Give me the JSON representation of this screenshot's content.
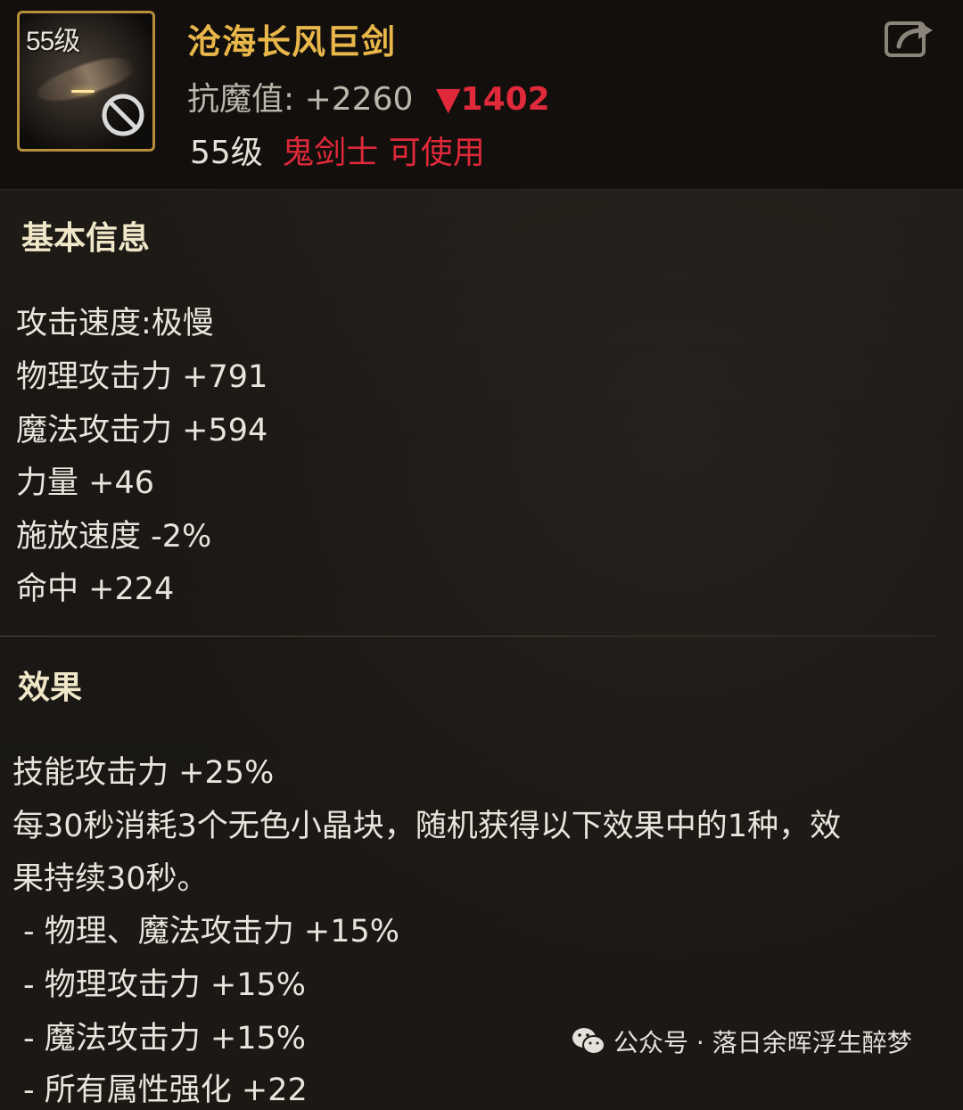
{
  "item": {
    "level_badge": "55级",
    "name": "沧海长风巨剑",
    "resist_label": "抗魔值:",
    "resist_value": "+2260",
    "resist_diff": "▼1402",
    "req_level": "55级",
    "req_class": "鬼剑士 可使用"
  },
  "colors": {
    "name": "#e9b64a",
    "warning_red": "#e0293a",
    "icon_border": "#b58f3b"
  },
  "basic": {
    "title": "基本信息",
    "stats": [
      "攻击速度:极慢",
      "物理攻击力 +791",
      "魔法攻击力 +594",
      "力量 +46",
      "施放速度 -2%",
      "命中 +224"
    ]
  },
  "effects": {
    "title": "效果",
    "lines": [
      "技能攻击力 +25%",
      "每30秒消耗3个无色小晶块，随机获得以下效果中的1种，效",
      "果持续30秒。"
    ],
    "sub_lines": [
      "- 物理、魔法攻击力 +15%",
      "- 物理攻击力 +15%",
      "- 魔法攻击力 +15%",
      "- 所有属性强化 +22"
    ]
  },
  "watermark": {
    "text": "公众号 · 落日余晖浮生醉梦",
    "icon": "wechat-icon"
  },
  "icons": {
    "share": "share-icon",
    "ban": "ban-icon"
  }
}
